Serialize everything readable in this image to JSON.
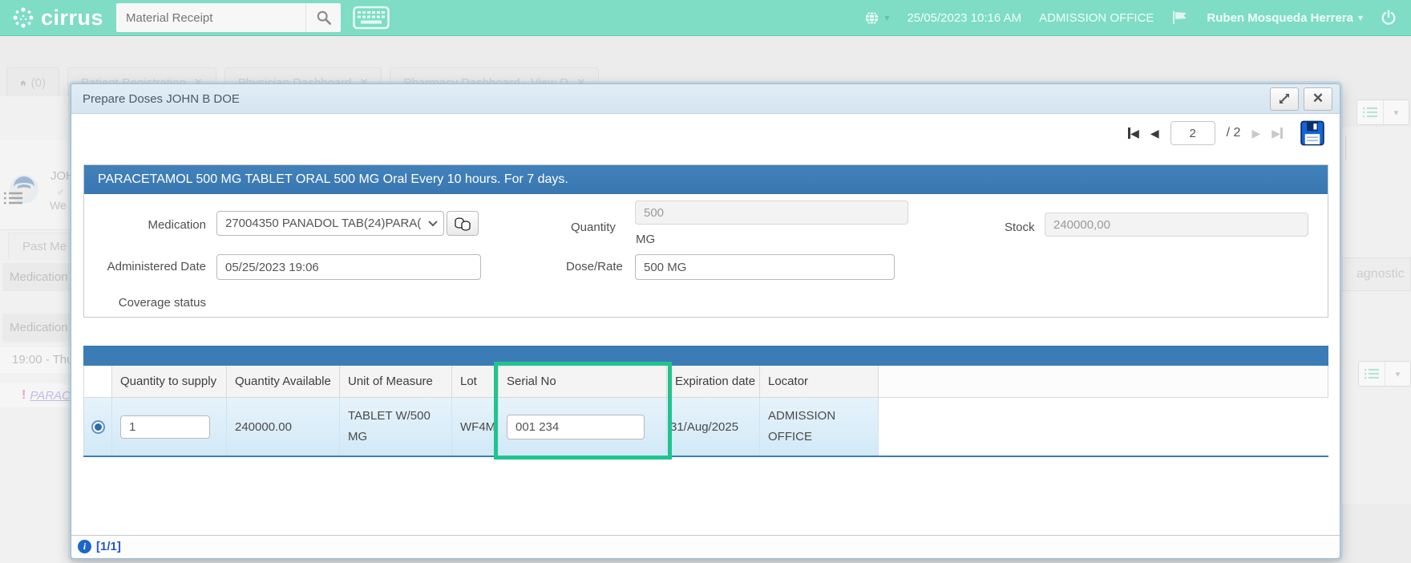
{
  "colors": {
    "brand_teal": "#7eddc4",
    "section_blue": "#3b7cb7",
    "highlight_green": "#21c48e",
    "link_blue": "#2457c5",
    "row_blue": "#ddeefa"
  },
  "icons": {
    "chevron_down": "▾",
    "close": "✕",
    "prev": "◀",
    "next": "▶",
    "info": "i"
  },
  "header": {
    "logo_text": "cirrus",
    "search_placeholder": "Material Receipt",
    "datetime": "25/05/2023 10:16 AM",
    "location": "ADMISSION OFFICE",
    "user_name": "Ruben Mosqueda Herrera"
  },
  "tabs": {
    "home_count": "(0)",
    "items": [
      {
        "label": "Patient Registration"
      },
      {
        "label": "Physician Dashboard"
      },
      {
        "label": "Pharmacy Dashboard - View D"
      }
    ]
  },
  "background": {
    "left": {
      "patient_name": "JOH",
      "gender": "♂",
      "detail": "We",
      "panel_tab": "Past Me",
      "row1": "Medication",
      "row2": "Medication",
      "row3": "19:00 - Thu",
      "alert": "!",
      "med_link": "PARACE"
    },
    "right": {
      "box_text": "agnostic"
    }
  },
  "modal": {
    "title": "Prepare Doses JOHN B DOE",
    "pagination": {
      "page_value": "2",
      "total_label": "/ 2"
    },
    "order_header": "PARACETAMOL 500 MG TABLET ORAL 500 MG Oral Every 10 hours. For 7 days.",
    "form": {
      "medication_label": "Medication",
      "medication_value": "27004350 PANADOL TAB(24)PARA(",
      "quantity_label": "Quantity",
      "quantity_value": "500",
      "quantity_unit": "MG",
      "stock_label": "Stock",
      "stock_value": "240000,00",
      "administered_date_label": "Administered Date",
      "administered_date_value": "05/25/2023 19:06",
      "dose_rate_label": "Dose/Rate",
      "dose_rate_value": "500 MG",
      "coverage_status_label": "Coverage status"
    },
    "table": {
      "headers": [
        "Quantity to supply",
        "Quantity Available",
        "Unit of Measure",
        "Lot",
        "Serial No",
        "Expiration date",
        "Locator"
      ],
      "row": {
        "quantity_to_supply": "1",
        "quantity_available": "240000.00",
        "unit_of_measure": "TABLET W/500 MG",
        "lot": "WF4M",
        "serial_no": "001 234",
        "expiration_date": "31/Aug/2025",
        "locator": "ADMISSION OFFICE"
      }
    },
    "footer": {
      "record_count": "[1/1]"
    }
  }
}
